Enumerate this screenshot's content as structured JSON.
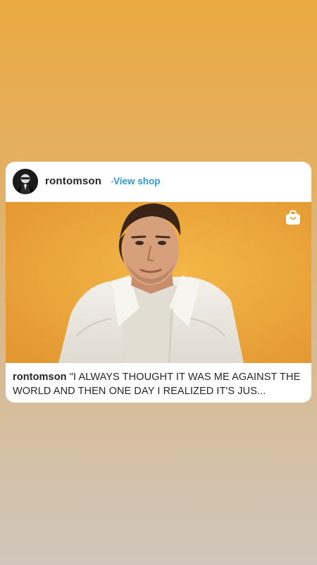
{
  "post": {
    "username": "rontomson",
    "separator": "·",
    "view_shop_label": "View shop",
    "caption_user": "rontomson",
    "caption_text": "\"I ALWAYS THOUGHT IT WAS ME AGAINST THE WORLD AND THEN ONE DAY I REALIZED IT'S JUS..."
  },
  "icons": {
    "avatar": "profile-avatar",
    "shop": "shopping-bag-icon"
  },
  "colors": {
    "background_top": "#eba941",
    "background_bottom": "#d0c6bc",
    "link": "#2f9bd6",
    "image_backdrop": "#eda53a"
  }
}
